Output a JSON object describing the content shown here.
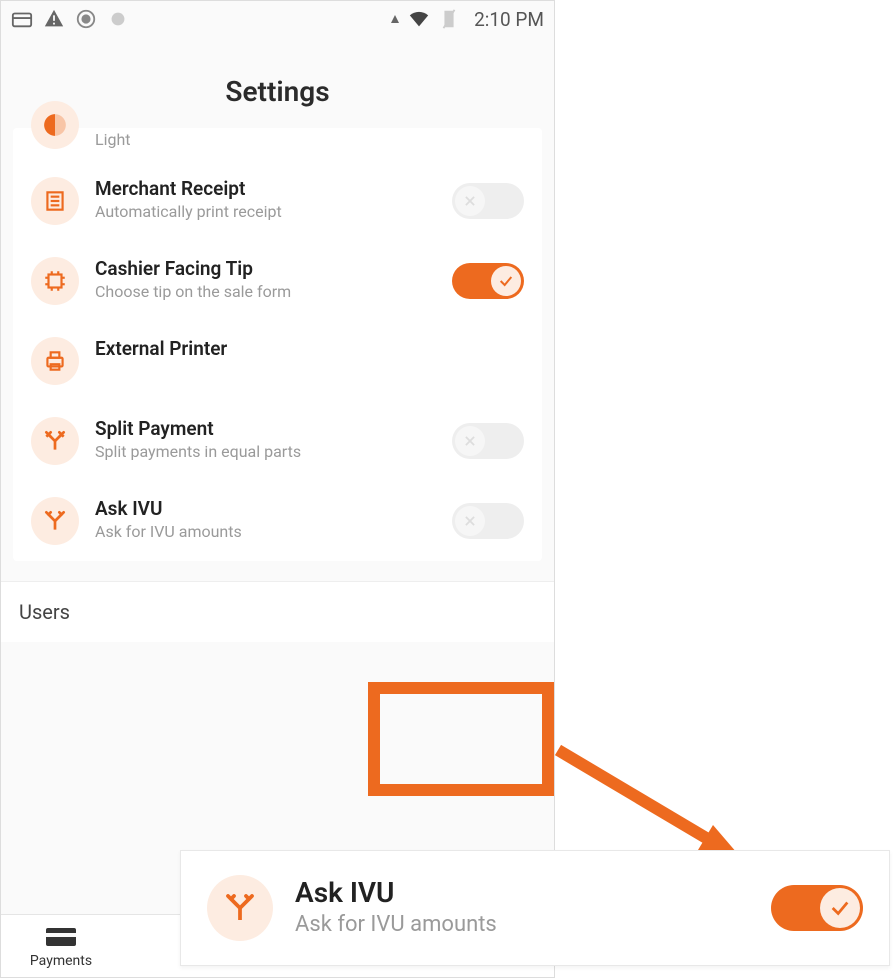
{
  "status_bar": {
    "time": "2:10 PM"
  },
  "page": {
    "title": "Settings"
  },
  "settings": {
    "theme": {
      "subtitle": "Light"
    },
    "merchant_receipt": {
      "title": "Merchant Receipt",
      "subtitle": "Automatically print receipt"
    },
    "cashier_tip": {
      "title": "Cashier Facing Tip",
      "subtitle": "Choose tip on the sale form"
    },
    "external_printer": {
      "title": "External Printer"
    },
    "split_payment": {
      "title": "Split Payment",
      "subtitle": "Split payments in equal parts"
    },
    "ask_ivu": {
      "title": "Ask IVU",
      "subtitle": "Ask for IVU amounts"
    }
  },
  "sections": {
    "users": "Users"
  },
  "tabs": {
    "payments": "Payments"
  },
  "overlay": {
    "title": "Ask IVU",
    "subtitle": "Ask for IVU amounts"
  }
}
